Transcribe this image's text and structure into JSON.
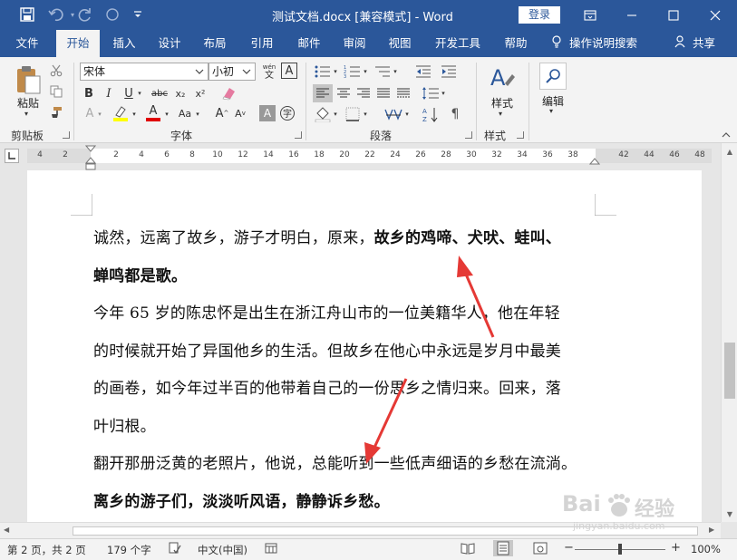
{
  "window": {
    "title": "测试文档.docx [兼容模式]  -  Word",
    "login_label": "登录"
  },
  "tabs": [
    "文件",
    "开始",
    "插入",
    "设计",
    "布局",
    "引用",
    "邮件",
    "审阅",
    "视图",
    "开发工具",
    "帮助"
  ],
  "tell_me": "操作说明搜索",
  "share": "共享",
  "ribbon": {
    "clipboard": {
      "paste_label": "粘贴",
      "group_label": "剪贴板"
    },
    "font": {
      "font_name": "宋体",
      "font_size": "小初",
      "group_label": "字体",
      "wen_glyph": "wén",
      "a_glyph": "A"
    },
    "paragraph": {
      "group_label": "段落"
    },
    "styles": {
      "label": "样式",
      "group_label": "样式"
    },
    "editing": {
      "label": "编辑"
    }
  },
  "ruler": {
    "numbers_left": [
      "4",
      "2"
    ],
    "numbers_right": [
      "2",
      "4",
      "6",
      "8",
      "10",
      "12",
      "14",
      "16",
      "18",
      "20",
      "22",
      "24",
      "26",
      "28",
      "30",
      "32",
      "34",
      "36",
      "38"
    ],
    "numbers_far": [
      "42",
      "44",
      "46",
      "48"
    ]
  },
  "document": {
    "lines": [
      {
        "normal": "诚然，远离了故乡，游子才明白，原来，",
        "bold": "故乡的鸡啼、犬吠、蛙叫、"
      },
      {
        "normal": "",
        "bold": "蝉鸣都是歌。"
      },
      {
        "normal": "今年 65 岁的陈忠怀是出生在浙江舟山市的一位美籍华人，他在年轻",
        "bold": ""
      },
      {
        "normal": "的时候就开始了异国他乡的生活。但故乡在他心中永远是岁月中最美",
        "bold": ""
      },
      {
        "normal": "的画卷，如今年过半百的他带着自己的一份思乡之情归来。回来，落",
        "bold": ""
      },
      {
        "normal": "叶归根。",
        "bold": ""
      },
      {
        "normal": "翻开那册泛黄的老照片，他说，总能听到一些低声细语的乡愁在流淌。",
        "bold": ""
      },
      {
        "normal": "",
        "bold": "离乡的游子们，淡淡听风语，静静诉乡愁。"
      }
    ]
  },
  "status": {
    "page": "第 2 页，共 2 页",
    "words": "179 个字",
    "language": "中文(中国)",
    "zoom": "100%"
  },
  "watermark": {
    "brand": "Bai",
    "brand2": "经验",
    "url": "jingyan.baidu.com"
  },
  "colors": {
    "brand": "#2b579a",
    "arrow": "#e53935"
  }
}
